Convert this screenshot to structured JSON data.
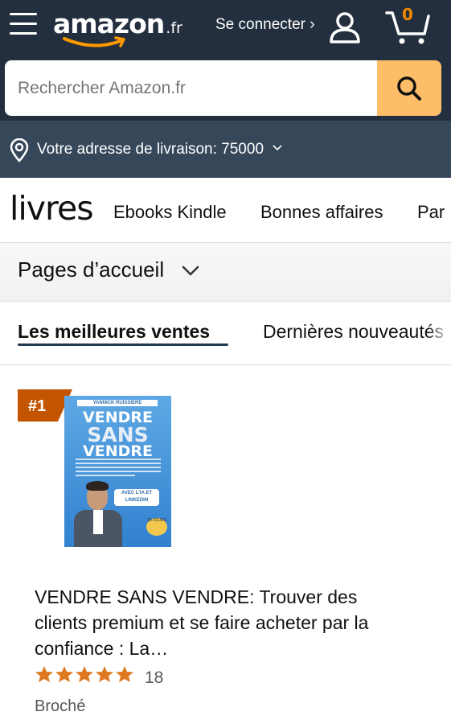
{
  "header": {
    "logo_word": "amazon",
    "logo_tld": ".fr",
    "signin_label": "Se connecter ›",
    "cart_count": "0"
  },
  "search": {
    "placeholder": "Rechercher Amazon.fr"
  },
  "delivery": {
    "label": "Votre adresse de livraison: 75000"
  },
  "subnav": {
    "brand": "livres",
    "links": [
      "Ebooks Kindle",
      "Bonnes affaires",
      "Par"
    ]
  },
  "pages": {
    "label": "Pages d’accueil"
  },
  "tabs": {
    "active": "Les meilleures ventes",
    "other": "Dernières nouveautés"
  },
  "product": {
    "rank": "#1",
    "cover": {
      "author": "YANNICK RUISSIERE",
      "line1": "VENDRE",
      "line2": "SANS",
      "line3": "VENDRE",
      "pill": "AVEC L'IA ET LINKEDIN",
      "badge": "30 JOURS"
    },
    "title": "VENDRE SANS VENDRE: Trouver des clients premium et se faire acheter par la confiance : La…",
    "rating": 5,
    "rating_count": "18",
    "format": "Broché"
  },
  "colors": {
    "header_bg": "#232f3e",
    "delivery_bg": "#37475a",
    "search_button": "#febd69",
    "star": "#de7921",
    "rank_badge": "#c45500"
  }
}
